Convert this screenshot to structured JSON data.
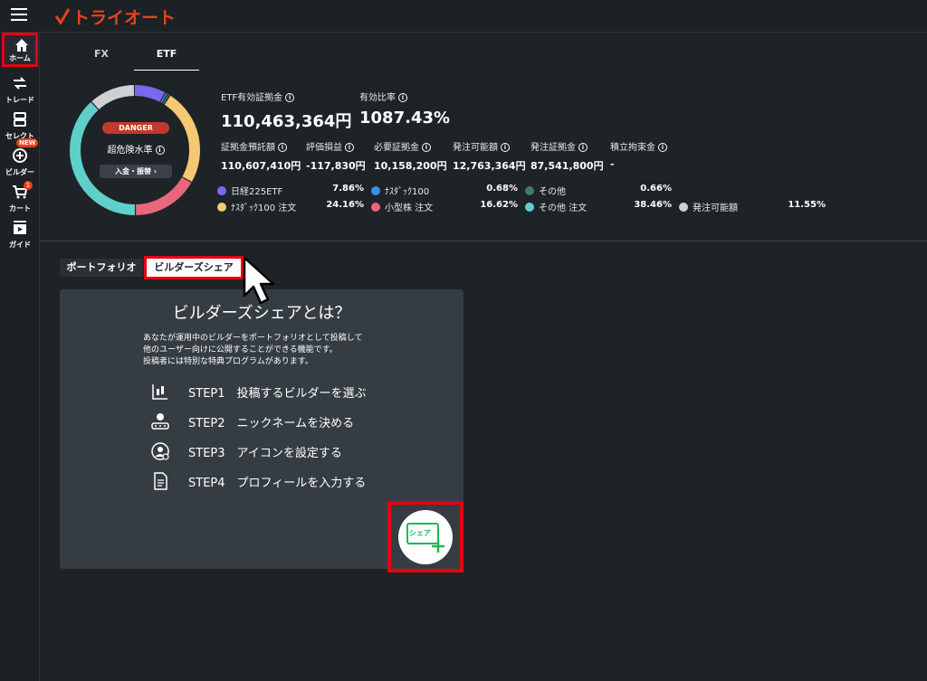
{
  "app": {
    "logo_text": "トライオート",
    "brand_color": "#e8411f"
  },
  "sidebar": {
    "items": [
      {
        "label": "ホーム",
        "icon": "home-icon"
      },
      {
        "label": "トレード",
        "icon": "trade-icon"
      },
      {
        "label": "セレクト",
        "icon": "select-icon"
      },
      {
        "label": "ビルダー",
        "icon": "builder-icon"
      },
      {
        "label": "カート",
        "icon": "cart-icon"
      },
      {
        "label": "ガイド",
        "icon": "guide-icon"
      }
    ],
    "new_badge": "NEW",
    "cart_count": "1"
  },
  "top_tabs": [
    "FX",
    "ETF"
  ],
  "gauge": {
    "badge": "DANGER",
    "level_label": "超危険水準",
    "deposit_button": "入金・振替"
  },
  "metrics": {
    "margin_label": "ETF有効証拠金",
    "margin_value": "110,463,364円",
    "ratio_label": "有効比率",
    "ratio_value": "1087.43%",
    "sub": [
      {
        "label": "証拠金預託額",
        "value": "110,607,410円"
      },
      {
        "label": "評価損益",
        "value": "-117,830円"
      },
      {
        "label": "必要証拠金",
        "value": "10,158,200円"
      },
      {
        "label": "発注可能額",
        "value": "12,763,364円"
      },
      {
        "label": "発注証拠金",
        "value": "87,541,800円"
      },
      {
        "label": "積立拘束金",
        "value": "-"
      }
    ]
  },
  "allocation": [
    {
      "name": "日経225ETF",
      "pct": "7.86%",
      "color": "#7b68ee"
    },
    {
      "name": "ﾅｽﾀﾞｯｸ100",
      "pct": "0.68%",
      "color": "#3b8fe8"
    },
    {
      "name": "その他",
      "pct": "0.66%",
      "color": "#3d7a70"
    },
    {
      "name": "ﾅｽﾀﾞｯｸ100 注文",
      "pct": "24.16%",
      "color": "#f5c971"
    },
    {
      "name": "小型株 注文",
      "pct": "16.62%",
      "color": "#e8677d"
    },
    {
      "name": "その他 注文",
      "pct": "38.46%",
      "color": "#5ed0c9"
    },
    {
      "name": "発注可能額",
      "pct": "11.55%",
      "color": "#d0d0d0"
    }
  ],
  "bottom_tabs": {
    "portfolio": "ポートフォリオ",
    "builder_share": "ビルダーズシェア"
  },
  "card": {
    "title": "ビルダーズシェアとは？",
    "desc_lines": [
      "あなたが運用中のビルダーをポートフォリオとして投稿して",
      "他のユーザー向けに公開することができる機能です。",
      "投稿者には特別な特典プログラムがあります。"
    ],
    "steps": [
      {
        "label": "STEP1　投稿するビルダーを選ぶ",
        "icon": "chart-select-icon"
      },
      {
        "label": "STEP2　ニックネームを決める",
        "icon": "nickname-icon"
      },
      {
        "label": "STEP3　アイコンを設定する",
        "icon": "avatar-settings-icon"
      },
      {
        "label": "STEP4　プロフィールを入力する",
        "icon": "profile-document-icon"
      }
    ],
    "share_button": "シェア"
  }
}
